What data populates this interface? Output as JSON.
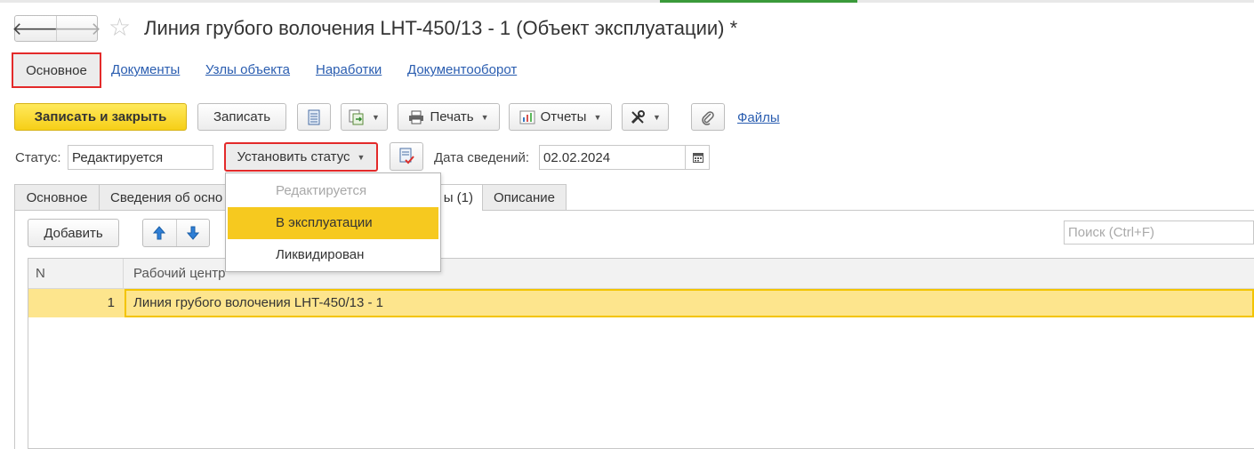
{
  "window": {
    "title": "Линия грубого волочения LHT-450/13 - 1 (Объект эксплуатации) *",
    "accent_color": "#f6cf17",
    "highlight_border_color": "#e32a2a"
  },
  "nav": {
    "back_icon": "arrow-left-icon",
    "forward_icon": "arrow-right-icon",
    "favorite_icon": "star-icon",
    "back_glyph": "🡐",
    "forward_glyph": "🡒",
    "star_glyph": "☆"
  },
  "sections": {
    "active": "Основное",
    "links": [
      "Документы",
      "Узлы объекта",
      "Наработки",
      "Документооборот"
    ]
  },
  "toolbar": {
    "save_close_label": "Записать и закрыть",
    "save_label": "Записать",
    "print_label": "Печать",
    "reports_label": "Отчеты",
    "files_label": "Файлы"
  },
  "status": {
    "label": "Статус:",
    "value": "Редактируется",
    "set_status_label": "Установить статус",
    "date_label": "Дата сведений:",
    "date_value": "02.02.2024"
  },
  "status_menu": {
    "items": [
      {
        "label": "Редактируется",
        "state": "disabled"
      },
      {
        "label": "В эксплуатации",
        "state": "highlighted"
      },
      {
        "label": "Ликвидирован",
        "state": "normal"
      }
    ]
  },
  "tabs": [
    {
      "label": "Основное"
    },
    {
      "label": "Сведения об осно"
    },
    {
      "label": "ы (1)"
    },
    {
      "label": "Описание"
    }
  ],
  "table_toolbar": {
    "add_label": "Добавить",
    "search_placeholder": "Поиск (Ctrl+F)"
  },
  "table": {
    "columns": [
      "N",
      "Рабочий центр"
    ],
    "rows": [
      {
        "n": "1",
        "work_center": "Линия грубого волочения LHT-450/13 - 1"
      }
    ]
  }
}
